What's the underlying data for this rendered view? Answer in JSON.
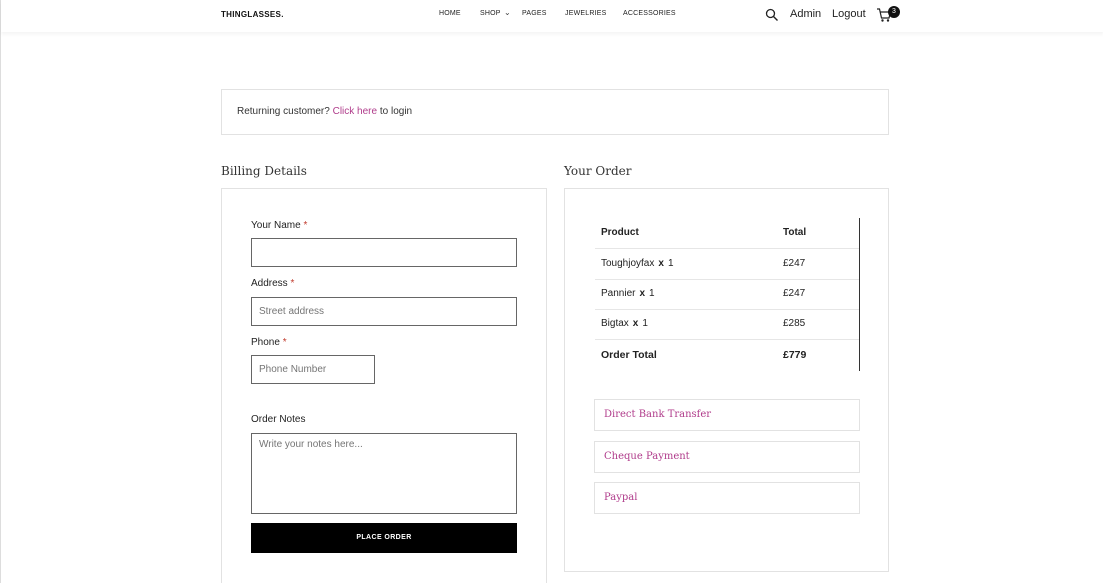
{
  "header": {
    "logo": "THINGLASSES.",
    "nav": [
      {
        "label": "HOME"
      },
      {
        "label": "SHOP"
      },
      {
        "label": "PAGES"
      },
      {
        "label": "JEWELRIES"
      },
      {
        "label": "ACCESSORIES"
      }
    ],
    "shop_chevron": "⌄",
    "admin": "Admin",
    "logout": "Logout",
    "cart_count": "3"
  },
  "returning": {
    "prefix": "Returning customer?",
    "link": "Click here",
    "suffix": "to login"
  },
  "billing": {
    "title": "Billing Details",
    "name_label": "Your Name",
    "name_value": "",
    "address_label": "Address",
    "address_placeholder": "Street address",
    "phone_label": "Phone",
    "phone_placeholder": "Phone Number",
    "notes_label": "Order Notes",
    "notes_placeholder": "Write your notes here...",
    "required_mark": "*",
    "place_order": "PLACE ORDER"
  },
  "order": {
    "title": "Your Order",
    "columns": [
      "Product",
      "Total"
    ],
    "items": [
      {
        "name": "Toughjoyfax",
        "qty": "1",
        "total": "£247"
      },
      {
        "name": "Pannier",
        "qty": "1",
        "total": "£247"
      },
      {
        "name": "Bigtax",
        "qty": "1",
        "total": "£285"
      }
    ],
    "qty_sep": "x",
    "total_label": "Order Total",
    "total_value": "£779",
    "payments": [
      "Direct Bank Transfer",
      "Cheque Payment",
      "Paypal"
    ]
  },
  "colors": {
    "accent": "#b03c8b",
    "button": "#000000"
  }
}
